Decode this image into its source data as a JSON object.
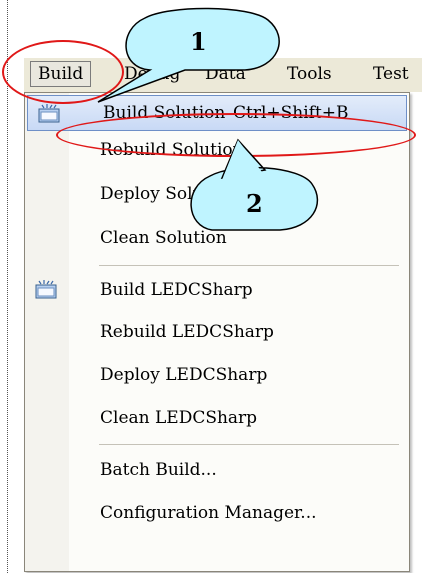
{
  "menubar": {
    "items": [
      {
        "label": "Build"
      },
      {
        "label": "Debug"
      },
      {
        "label": "Data"
      },
      {
        "label": "Tools"
      },
      {
        "label": "Test"
      }
    ]
  },
  "menu": {
    "items": [
      {
        "label": "Build Solution",
        "shortcut": "Ctrl+Shift+B"
      },
      {
        "label": "Rebuild Solution"
      },
      {
        "label": "Deploy Solution"
      },
      {
        "label": "Clean Solution"
      },
      {
        "label": "Build LEDCSharp"
      },
      {
        "label": "Rebuild LEDCSharp"
      },
      {
        "label": "Deploy LEDCSharp"
      },
      {
        "label": "Clean LEDCSharp"
      },
      {
        "label": "Batch Build..."
      },
      {
        "label": "Configuration Manager..."
      }
    ]
  },
  "callouts": {
    "one": "1",
    "two": "2",
    "fill_color": "#bff4ff",
    "ring_color": "#e01818"
  },
  "icons": [
    "build-icon",
    "build-project-icon"
  ]
}
